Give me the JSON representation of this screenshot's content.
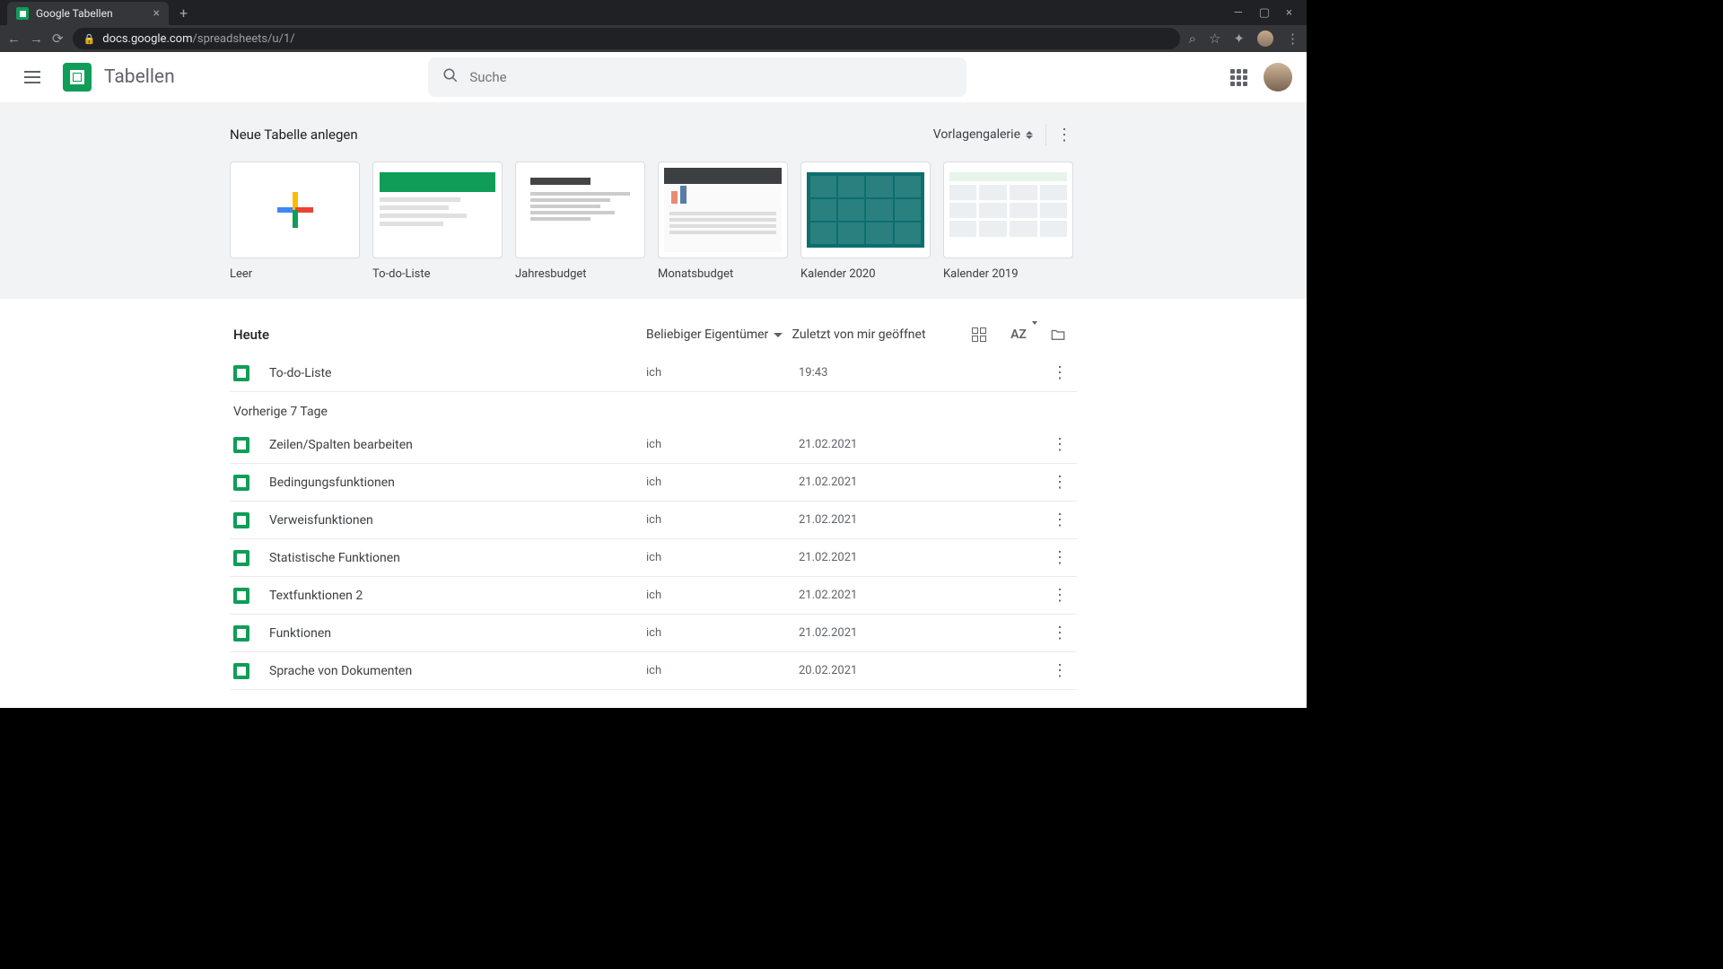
{
  "browser": {
    "tab_title": "Google Tabellen",
    "url_host": "docs.google.com",
    "url_path": "/spreadsheets/u/1/"
  },
  "app": {
    "title": "Tabellen",
    "search_placeholder": "Suche"
  },
  "templates": {
    "section_title": "Neue Tabelle anlegen",
    "gallery_label": "Vorlagengalerie",
    "items": [
      {
        "label": "Leer"
      },
      {
        "label": "To-do-Liste"
      },
      {
        "label": "Jahresbudget"
      },
      {
        "label": "Monatsbudget"
      },
      {
        "label": "Kalender 2020"
      },
      {
        "label": "Kalender 2019"
      }
    ]
  },
  "files": {
    "owner_filter": "Beliebiger Eigentümer",
    "sort_label": "Zuletzt von mir geöffnet",
    "sections": [
      {
        "label": "Heute",
        "rows": [
          {
            "name": "To-do-Liste",
            "owner": "ich",
            "date": "19:43"
          }
        ]
      },
      {
        "label": "Vorherige 7 Tage",
        "rows": [
          {
            "name": "Zeilen/Spalten bearbeiten",
            "owner": "ich",
            "date": "21.02.2021"
          },
          {
            "name": "Bedingungsfunktionen",
            "owner": "ich",
            "date": "21.02.2021"
          },
          {
            "name": "Verweisfunktionen",
            "owner": "ich",
            "date": "21.02.2021"
          },
          {
            "name": "Statistische Funktionen",
            "owner": "ich",
            "date": "21.02.2021"
          },
          {
            "name": "Textfunktionen 2",
            "owner": "ich",
            "date": "21.02.2021"
          },
          {
            "name": "Funktionen",
            "owner": "ich",
            "date": "21.02.2021"
          },
          {
            "name": "Sprache von Dokumenten",
            "owner": "ich",
            "date": "20.02.2021"
          }
        ]
      }
    ]
  }
}
